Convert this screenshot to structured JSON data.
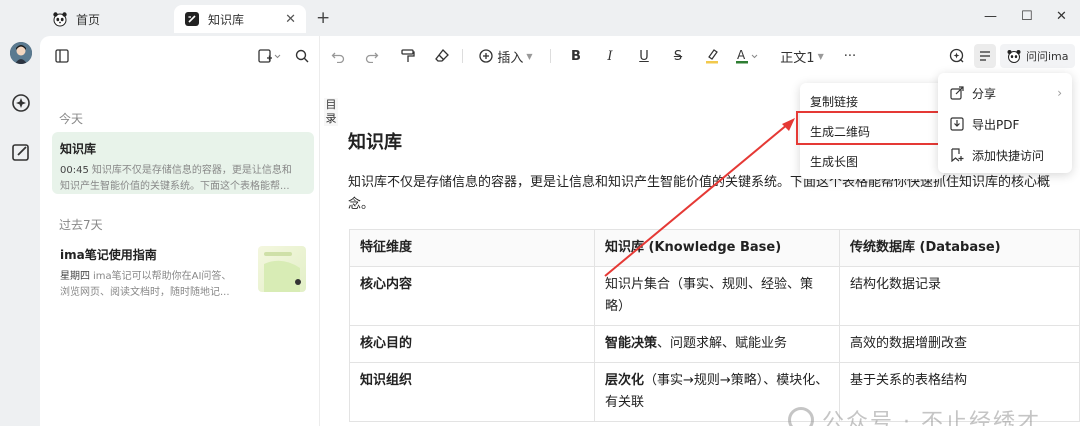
{
  "tabs": [
    {
      "label": "首页",
      "icon": "panda-icon"
    },
    {
      "label": "知识库",
      "icon": "notebook-icon",
      "active": true
    }
  ],
  "sidebar": {
    "sections": [
      {
        "label": "今天"
      },
      {
        "label": "过去7天"
      }
    ],
    "notes": [
      {
        "title": "知识库",
        "time": "00:45",
        "snippet_line1": "知识库不仅是存储信息的容器，更是让信息和",
        "snippet_line2": "知识产生智能价值的关键系统。下面这个表格能帮..."
      },
      {
        "title": "ima笔记使用指南",
        "time": "星期四",
        "snippet_line1": "ima笔记可以帮助你在AI问答、",
        "snippet_line2": "浏览网页、阅读文档时，随时随地记..."
      }
    ]
  },
  "toolbar": {
    "insert_label": "插入",
    "text_style_label": "正文1",
    "more_label": "···",
    "ask_label": "问问ima"
  },
  "document": {
    "toc_label": "目录",
    "title": "知识库",
    "paragraph": "知识库不仅是存储信息的容器，更是让信息和知识产生智能价值的关键系统。下面这个表格能帮你快速抓住知识库的核心概念。",
    "table": {
      "headers": [
        "特征维度",
        "知识库 (Knowledge Base)",
        "传统数据库 (Database)"
      ],
      "rows": [
        [
          "核心内容",
          "知识片集合（事实、规则、经验、策略）",
          "结构化数据记录"
        ],
        [
          "核心目的",
          "智能决策、问题求解、赋能业务",
          "高效的数据增删改查"
        ],
        [
          "知识组织",
          "层次化（事实→规则→策略）、模块化、有关联",
          "基于关系的表格结构"
        ]
      ],
      "row_bold_prefix": [
        "",
        "智能决策",
        "层次化"
      ]
    }
  },
  "share_submenu": {
    "items": [
      "复制链接",
      "生成二维码",
      "生成长图"
    ],
    "highlighted_index": 1
  },
  "share_menu": {
    "items": [
      {
        "label": "分享",
        "icon": "share-icon",
        "has_submenu": true
      },
      {
        "label": "导出PDF",
        "icon": "export-icon"
      },
      {
        "label": "添加快捷访问",
        "icon": "bookmark-icon"
      }
    ]
  },
  "watermark": "公众号 · 不止经绣才",
  "colors": {
    "active_note_bg": "#e8f3ea",
    "highlight_red": "#e53935",
    "window_bg": "#eef0f2"
  }
}
